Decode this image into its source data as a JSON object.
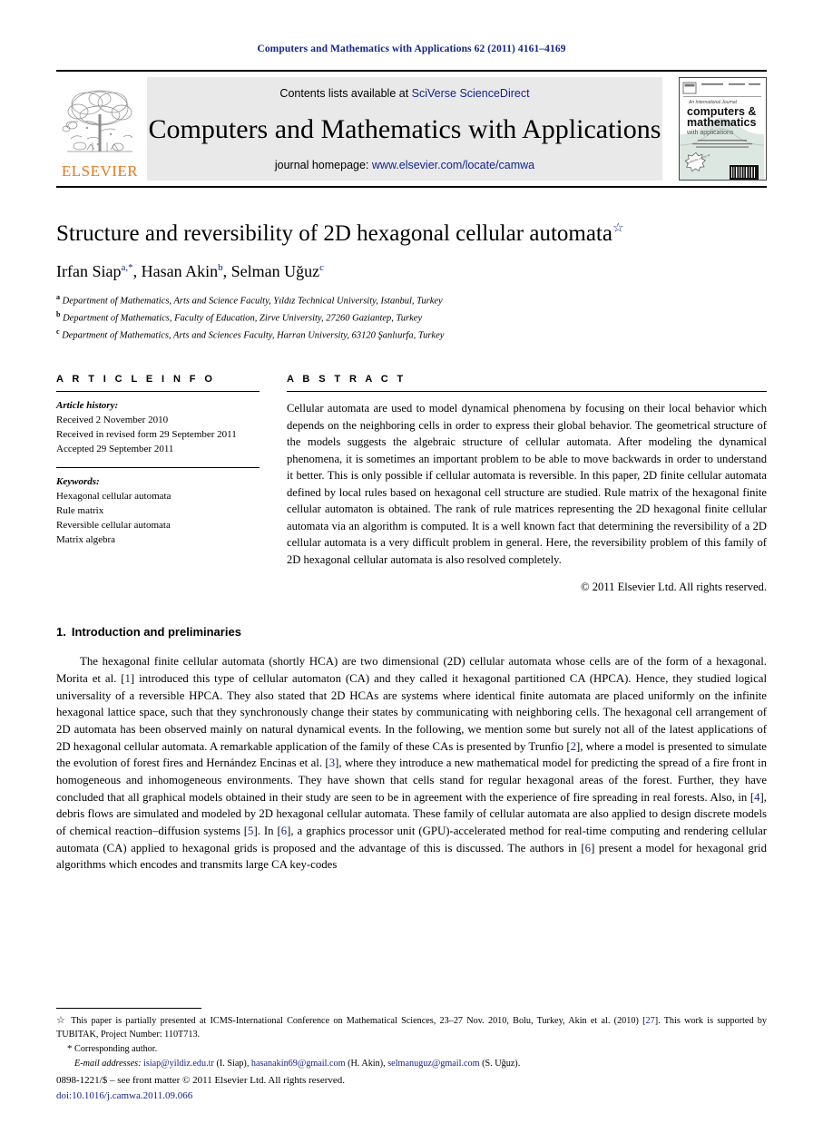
{
  "running_head": "Computers and Mathematics with Applications 62 (2011) 4161–4169",
  "masthead": {
    "elsevier_wordmark": "ELSEVIER",
    "contents_prefix": "Contents lists available at ",
    "contents_link": "SciVerse ScienceDirect",
    "journal_title": "Computers and Mathematics with Applications",
    "homepage_prefix": "journal homepage: ",
    "homepage_link": "www.elsevier.com/locate/camwa",
    "cover": {
      "kicker": "An International Journal",
      "line1": "computers &",
      "line2": "mathematics",
      "line3": "with applications",
      "badge": "available online at"
    }
  },
  "article": {
    "title": "Structure and reversibility of 2D hexagonal cellular automata",
    "title_footnote_symbol": "☆",
    "authors": [
      {
        "name": "Irfan Siap",
        "sup": "a,*"
      },
      {
        "name": "Hasan Akin",
        "sup": "b"
      },
      {
        "name": "Selman Uğuz",
        "sup": "c"
      }
    ],
    "affiliations": [
      {
        "sup": "a",
        "text": "Department of Mathematics, Arts and Science Faculty, Yıldız Technical University, Istanbul, Turkey"
      },
      {
        "sup": "b",
        "text": "Department of Mathematics, Faculty of Education, Zirve University, 27260 Gaziantep, Turkey"
      },
      {
        "sup": "c",
        "text": "Department of Mathematics, Arts and Sciences Faculty, Harran University, 63120 Şanlıurfa, Turkey"
      }
    ]
  },
  "article_info": {
    "heading": "A R T I C L E   I N F O",
    "history_label": "Article history:",
    "history": [
      "Received 2 November 2010",
      "Received in revised form 29 September 2011",
      "Accepted 29 September 2011"
    ],
    "keywords_label": "Keywords:",
    "keywords": [
      "Hexagonal cellular automata",
      "Rule matrix",
      "Reversible cellular automata",
      "Matrix algebra"
    ]
  },
  "abstract": {
    "heading": "A B S T R A C T",
    "text": "Cellular automata are used to model dynamical phenomena by focusing on their local behavior which depends on the neighboring cells in order to express their global behavior. The geometrical structure of the models suggests the algebraic structure of cellular automata. After modeling the dynamical phenomena, it is sometimes an important problem to be able to move backwards in order to understand it better. This is only possible if cellular automata is reversible. In this paper, 2D finite cellular automata defined by local rules based on hexagonal cell structure are studied. Rule matrix of the hexagonal finite cellular automaton is obtained. The rank of rule matrices representing the 2D hexagonal finite cellular automata via an algorithm is computed. It is a well known fact that determining the reversibility of a 2D cellular automata is a very difficult problem in general. Here, the reversibility problem of this family of 2D hexagonal cellular automata is also resolved completely.",
    "copyright": "© 2011 Elsevier Ltd. All rights reserved."
  },
  "body": {
    "section_number": "1.",
    "section_title": "Introduction and preliminaries",
    "paragraph_parts": [
      {
        "t": "The hexagonal finite cellular automata (shortly HCA) are two dimensional (2D) cellular automata whose cells are of the form of a hexagonal. Morita et al. ["
      },
      {
        "t": "1",
        "link": true
      },
      {
        "t": "] introduced this type of cellular automaton (CA) and they called it hexagonal partitioned CA (HPCA). Hence, they studied logical universality of a reversible HPCA. They also stated that 2D HCAs are systems where identical finite automata are placed uniformly on the infinite hexagonal lattice space, such that they synchronously change their states by communicating with neighboring cells. The hexagonal cell arrangement of 2D automata has been observed mainly on natural dynamical events. In the following, we mention some but surely not all of the latest applications of 2D hexagonal cellular automata. A remarkable application of the family of these CAs is presented by Trunfio ["
      },
      {
        "t": "2",
        "link": true
      },
      {
        "t": "], where a model is presented to simulate the evolution of forest fires and Hernández Encinas et al. ["
      },
      {
        "t": "3",
        "link": true
      },
      {
        "t": "], where they introduce a new mathematical model for predicting the spread of a fire front in homogeneous and inhomogeneous environments. They have shown that cells stand for regular hexagonal areas of the forest. Further, they have concluded that all graphical models obtained in their study are seen to be in agreement with the experience of fire spreading in real forests. Also, in ["
      },
      {
        "t": "4",
        "link": true
      },
      {
        "t": "], debris flows are simulated and modeled by 2D hexagonal cellular automata. These family of cellular automata are also applied to design discrete models of chemical reaction–diffusion systems ["
      },
      {
        "t": "5",
        "link": true
      },
      {
        "t": "]. In ["
      },
      {
        "t": "6",
        "link": true
      },
      {
        "t": "], a graphics processor unit (GPU)-accelerated method for real-time computing and rendering cellular automata (CA) applied to hexagonal grids is proposed and the advantage of this is discussed. The authors in ["
      },
      {
        "t": "6",
        "link": true
      },
      {
        "t": "] present a model for hexagonal grid algorithms which encodes and transmits large CA key-codes"
      }
    ]
  },
  "footnotes": {
    "star_symbol": "☆",
    "star_parts": [
      {
        "t": "This paper is partially presented at ICMS-International Conference on Mathematical Sciences, 23–27 Nov. 2010, Bolu, Turkey, Akin et al. (2010) ["
      },
      {
        "t": "27",
        "link": true
      },
      {
        "t": "]. This work is supported by TUBITAK, Project Number: 110T713."
      }
    ],
    "corresponding_symbol": "*",
    "corresponding_text": "Corresponding author.",
    "email_label": "E-mail addresses:",
    "emails": [
      {
        "address": "isiap@yildiz.edu.tr",
        "owner": "(I. Siap)"
      },
      {
        "address": "hasanakin69@gmail.com",
        "owner": "(H. Akin)"
      },
      {
        "address": "selmanuguz@gmail.com",
        "owner": "(S. Uğuz)"
      }
    ]
  },
  "imprint": {
    "issn_line": "0898-1221/$ – see front matter © 2011 Elsevier Ltd. All rights reserved.",
    "doi": "doi:10.1016/j.camwa.2011.09.066"
  },
  "colors": {
    "link_blue": "#14248a",
    "elsevier_orange": "#E87722",
    "band_grey": "#e9e9e9"
  }
}
